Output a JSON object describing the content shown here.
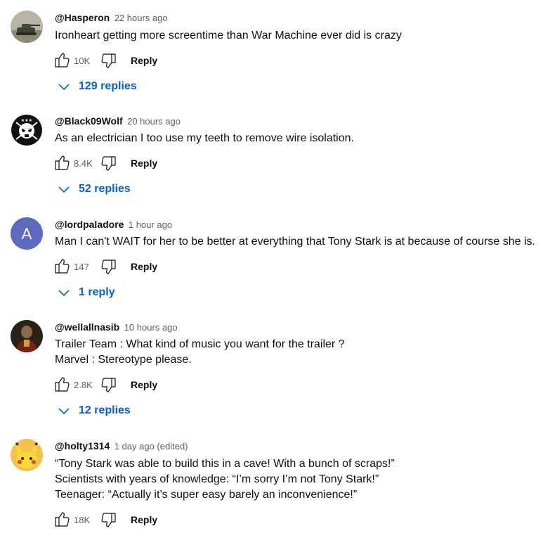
{
  "comments": [
    {
      "author": "@Hasperon",
      "time": "22 hours ago",
      "lines": [
        "Ironheart getting more screentime than War Machine ever did is crazy"
      ],
      "likes": "10K",
      "reply_label": "Reply",
      "replies_label": "129 replies",
      "avatar_icon": "tank-avatar"
    },
    {
      "author": "@Black09Wolf",
      "time": "20 hours ago",
      "lines": [
        "As an electrician I too use my teeth to remove wire isolation."
      ],
      "likes": "8.4K",
      "reply_label": "Reply",
      "replies_label": "52 replies",
      "avatar_icon": "skull-emblem-avatar"
    },
    {
      "author": "@lordpaladore",
      "time": "1 hour ago",
      "lines": [
        "Man I can't WAIT for her to be better at everything that Tony Stark is at because of course she is."
      ],
      "likes": "147",
      "reply_label": "Reply",
      "replies_label": "1 reply",
      "avatar_letter": "A",
      "avatar_color": "#5c6bc0"
    },
    {
      "author": "@wellallnasib",
      "time": "10 hours ago",
      "lines": [
        "Trailer Team : What kind of music you want for the trailer ?",
        "Marvel : Stereotype please."
      ],
      "likes": "2.8K",
      "reply_label": "Reply",
      "replies_label": "12 replies",
      "avatar_icon": "character-avatar"
    },
    {
      "author": "@holty1314",
      "time": "1 day ago (edited)",
      "lines": [
        "“Tony Stark was able to build this in a cave! With a bunch of scraps!”",
        "Scientists with years of knowledge: “I’m sorry I’m not Tony Stark!”",
        "Teenager: “Actually it’s super easy barely an inconvenience!”"
      ],
      "likes": "18K",
      "reply_label": "Reply",
      "avatar_icon": "pikachu-avatar"
    }
  ],
  "colors": {
    "link": "#065fd4",
    "meta": "#606060",
    "text": "#0f0f0f"
  }
}
